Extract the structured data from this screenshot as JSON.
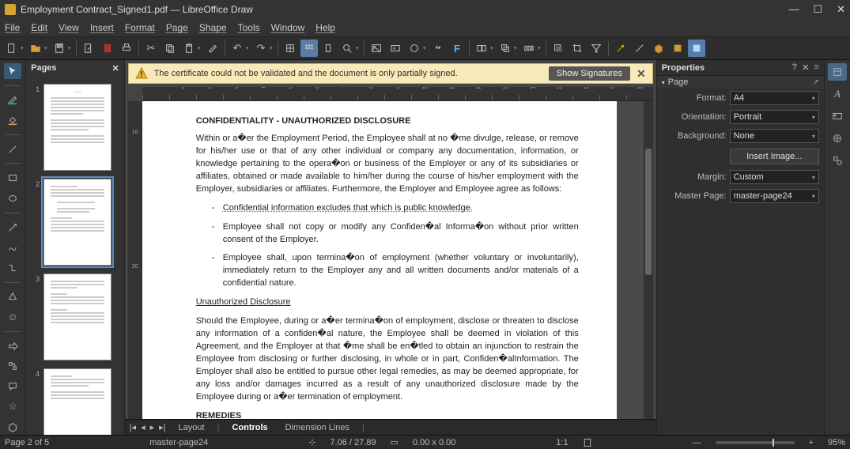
{
  "title": "Employment Contract_Signed1.pdf — LibreOffice Draw",
  "menu": [
    "File",
    "Edit",
    "View",
    "Insert",
    "Format",
    "Page",
    "Shape",
    "Tools",
    "Window",
    "Help"
  ],
  "infobar": {
    "message": "The certificate could not be validated and the document is only partially signed.",
    "button": "Show Signatures"
  },
  "pages_panel_title": "Pages",
  "thumbs": [
    1,
    2,
    3,
    4
  ],
  "selected_thumb": 2,
  "ruler_h": [
    "1",
    "2",
    "3",
    "4",
    "5",
    "6",
    "7",
    "8",
    "9",
    "10",
    "11",
    "12",
    "13",
    "14",
    "15",
    "16",
    "17",
    "18"
  ],
  "ruler_v": [
    "",
    "10",
    "",
    "",
    "",
    "",
    "20",
    ""
  ],
  "doc": {
    "h1": "CONFIDENTIALITY - UNAUTHORIZED DISCLOSURE",
    "p1": "Within or   a�er the Employment   Period,  the Employee shall    at  no  �me divulge,   release,  or remove for    his/her  use  or    that  of  any  other  individual  or  company  any  documentation, information, or knowledge pertaining to the opera�on or business of the Employer or any of its subsidiaries or affiliates,    obtained or made available to him/her during the course of        his/her employment  with the Employer,    subsidiaries  or  affiliates.  Furthermore,  the Employer   and Employee agree as follows:",
    "li1": "Confidential information excludes that which is public knowledge.",
    "li2": "Employee shall not copy or modify any Confiden�al Informa�on without prior written consent of the Employer.",
    "li3": "Employee shall, upon termina�on of employment (whether voluntary or involuntarily), immediately return to the Employer any and all written documents and/or materials of a confidential nature.",
    "h2": "Unauthorized Disclosure",
    "p2": "Should the Employee, during or a�er termina�on of employment, disclose or threaten to disclose any information of   a confiden�al  nature,  the Employee shall    be deemed in violation of    this Agreement, and the Employer at that �me shall be en�tled to obtain an injunction to restrain the Employee from disclosing or further disclosing,    in whole or in part,    Confiden�alInformation. The Employer   shall   also be entitled to pursue other       legal  remedies,  as  may  be deemed appropriate,  for  any loss and/or damages incurred as a result       of  any unauthorized disclosure made by the Employee during or a�er termination of employment.",
    "h3": "REMEDIES"
  },
  "nav_tabs": {
    "layout": "Layout",
    "controls": "Controls",
    "dim": "Dimension Lines"
  },
  "properties": {
    "title": "Properties",
    "section": "Page",
    "format_label": "Format:",
    "format_value": "A4",
    "orientation_label": "Orientation:",
    "orientation_value": "Portrait",
    "background_label": "Background:",
    "background_value": "None",
    "insert_image": "Insert Image...",
    "margin_label": "Margin:",
    "margin_value": "Custom",
    "master_label": "Master Page:",
    "master_value": "master-page24"
  },
  "status": {
    "page": "Page 2 of 5",
    "master": "master-page24",
    "pos": "7.06 / 27.89",
    "size": "0.00 x 0.00",
    "scale": "1:1",
    "zoom": "95%"
  }
}
